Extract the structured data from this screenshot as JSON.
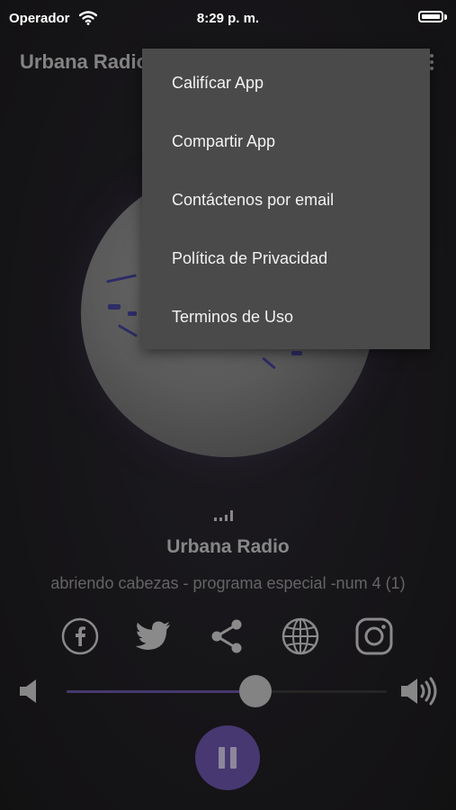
{
  "status_bar": {
    "carrier": "Operador",
    "time": "8:29 p. m."
  },
  "app": {
    "title": "Urbana Radio"
  },
  "menu": {
    "items": [
      {
        "label": "Califícar App"
      },
      {
        "label": "Compartir App"
      },
      {
        "label": "Contáctenos por email"
      },
      {
        "label": "Política de Privacidad"
      },
      {
        "label": "Terminos de Uso"
      }
    ]
  },
  "player": {
    "station": "Urbana Radio",
    "track": "abriendo cabezas - programa especial -num 4 (1)",
    "volume_fraction": 0.59,
    "state": "playing"
  },
  "social_icons": [
    "facebook-icon",
    "twitter-icon",
    "share-icon",
    "globe-icon",
    "instagram-icon"
  ],
  "colors": {
    "accent": "#6d56b0",
    "menu_bg": "#4a4a4a"
  }
}
